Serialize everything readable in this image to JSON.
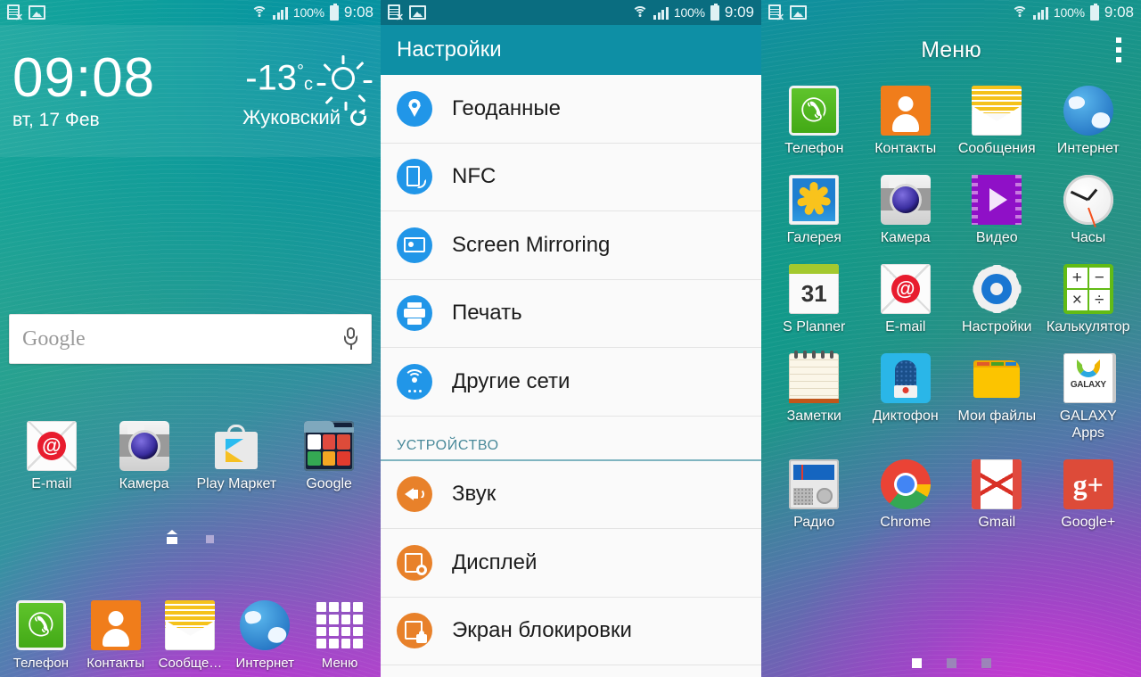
{
  "screen_home": {
    "status_bar": {
      "icons_left": [
        "sim-card-error-icon",
        "image-icon"
      ],
      "wifi_icon": "wifi-icon",
      "signal_icon": "cellular-signal-icon",
      "battery_percent": "100%",
      "battery_icon": "battery-full-icon",
      "time": "9:08"
    },
    "widget": {
      "clock": "09:08",
      "date": "вт, 17 Фев",
      "temperature": "-13",
      "degree": "°",
      "unit": "c",
      "city": "Жуковский",
      "weather_icon": "sun-icon",
      "refresh_icon": "refresh-icon"
    },
    "search": {
      "placeholder": "Google",
      "mic_icon": "microphone-icon"
    },
    "apps": [
      {
        "label": "E-mail",
        "icon": "email-icon"
      },
      {
        "label": "Камера",
        "icon": "camera-icon"
      },
      {
        "label": "Play Маркет",
        "icon": "play-store-icon"
      },
      {
        "label": "Google",
        "icon": "google-folder-icon"
      }
    ],
    "page_indicator": {
      "count": 2,
      "active": 0
    },
    "dock": [
      {
        "label": "Телефон",
        "icon": "phone-icon"
      },
      {
        "label": "Контакты",
        "icon": "contacts-icon"
      },
      {
        "label": "Сообще…",
        "icon": "messages-icon"
      },
      {
        "label": "Интернет",
        "icon": "internet-icon"
      },
      {
        "label": "Меню",
        "icon": "apps-grid-icon"
      }
    ]
  },
  "screen_settings": {
    "status_bar": {
      "battery_percent": "100%",
      "time": "9:09"
    },
    "title": "Настройки",
    "items": [
      {
        "label": "Геоданные",
        "icon": "location-pin-icon",
        "color": "#2196e8",
        "type": "row"
      },
      {
        "label": "NFC",
        "icon": "nfc-icon",
        "color": "#2196e8",
        "type": "row"
      },
      {
        "label": "Screen Mirroring",
        "icon": "screen-mirroring-icon",
        "color": "#2196e8",
        "type": "row"
      },
      {
        "label": "Печать",
        "icon": "printer-icon",
        "color": "#2196e8",
        "type": "row"
      },
      {
        "label": "Другие сети",
        "icon": "other-networks-icon",
        "color": "#2196e8",
        "type": "row"
      },
      {
        "label": "УСТРОЙСТВО",
        "type": "section"
      },
      {
        "label": "Звук",
        "icon": "sound-icon",
        "color": "#e8812a",
        "type": "row"
      },
      {
        "label": "Дисплей",
        "icon": "display-icon",
        "color": "#e8812a",
        "type": "row"
      },
      {
        "label": "Экран блокировки",
        "icon": "lock-screen-icon",
        "color": "#e8812a",
        "type": "row"
      }
    ]
  },
  "screen_menu": {
    "status_bar": {
      "battery_percent": "100%",
      "time": "9:08"
    },
    "title": "Меню",
    "overflow_icon": "more-options-icon",
    "apps": [
      {
        "label": "Телефон",
        "icon": "phone-icon"
      },
      {
        "label": "Контакты",
        "icon": "contacts-icon"
      },
      {
        "label": "Сообщения",
        "icon": "messages-icon"
      },
      {
        "label": "Интернет",
        "icon": "internet-icon"
      },
      {
        "label": "Галерея",
        "icon": "gallery-icon"
      },
      {
        "label": "Камера",
        "icon": "camera-icon"
      },
      {
        "label": "Видео",
        "icon": "video-icon"
      },
      {
        "label": "Часы",
        "icon": "clock-icon"
      },
      {
        "label": "S Planner",
        "icon": "calendar-icon",
        "badge": "31"
      },
      {
        "label": "E-mail",
        "icon": "email-icon"
      },
      {
        "label": "Настройки",
        "icon": "settings-gear-icon"
      },
      {
        "label": "Калькулятор",
        "icon": "calculator-icon"
      },
      {
        "label": "Заметки",
        "icon": "notes-icon"
      },
      {
        "label": "Диктофон",
        "icon": "voice-recorder-icon"
      },
      {
        "label": "Мои файлы",
        "icon": "my-files-icon"
      },
      {
        "label": "GALAXY Apps",
        "icon": "galaxy-apps-icon",
        "badge": "GALAXY"
      },
      {
        "label": "Радио",
        "icon": "radio-icon"
      },
      {
        "label": "Chrome",
        "icon": "chrome-icon"
      },
      {
        "label": "Gmail",
        "icon": "gmail-icon"
      },
      {
        "label": "Google+",
        "icon": "google-plus-icon",
        "badge": "g+"
      }
    ],
    "page_indicator": {
      "count": 3,
      "active": 0
    }
  },
  "calculator_keys": [
    "+",
    "−",
    "×",
    "÷"
  ]
}
